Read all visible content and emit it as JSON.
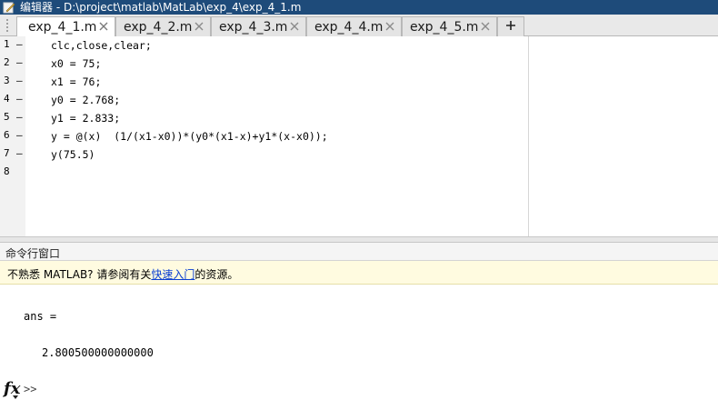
{
  "window": {
    "title": "编辑器 - D:\\project\\matlab\\MatLab\\exp_4\\exp_4_1.m",
    "icon": "pencil-note-icon"
  },
  "tabs": [
    {
      "label": "exp_4_1.m",
      "active": true
    },
    {
      "label": "exp_4_2.m",
      "active": false
    },
    {
      "label": "exp_4_3.m",
      "active": false
    },
    {
      "label": "exp_4_4.m",
      "active": false
    },
    {
      "label": "exp_4_5.m",
      "active": false
    }
  ],
  "tab_add_label": "+",
  "editor": {
    "lines": [
      {
        "num": "1",
        "mark": "–",
        "code": "clc,close,clear;"
      },
      {
        "num": "2",
        "mark": "–",
        "code": "x0 = 75;"
      },
      {
        "num": "3",
        "mark": "–",
        "code": "x1 = 76;"
      },
      {
        "num": "4",
        "mark": "–",
        "code": "y0 = 2.768;"
      },
      {
        "num": "5",
        "mark": "–",
        "code": "y1 = 2.833;"
      },
      {
        "num": "6",
        "mark": "–",
        "code": "y = @(x)  (1/(x1-x0))*(y0*(x1-x)+y1*(x-x0));"
      },
      {
        "num": "7",
        "mark": "–",
        "code": "y(75.5)"
      },
      {
        "num": "8",
        "mark": "",
        "code": ""
      }
    ]
  },
  "command_window": {
    "title": "命令行窗口",
    "notice_prefix": "不熟悉 MATLAB? 请参阅有关",
    "notice_link": "快速入门",
    "notice_suffix": "的资源。",
    "output_label": "ans =",
    "output_value": "2.800500000000000",
    "fx_label": "fx",
    "prompt": ">>"
  },
  "colors": {
    "titlebar": "#1e4b7a",
    "link": "#0b3fd1",
    "notice_bg": "#fffbe0"
  }
}
